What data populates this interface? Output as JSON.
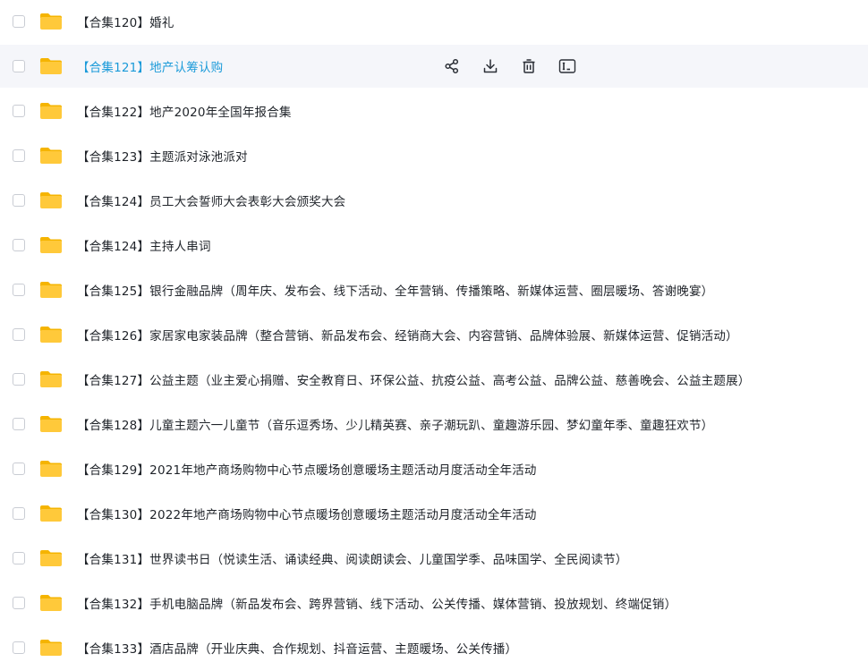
{
  "colors": {
    "folder": "#ffc93a",
    "folder_tab": "#f5b400",
    "hover_background": "#f5f6fa",
    "hover_text": "#1a9ad9",
    "text": "#1f2329",
    "icon": "#2b2f36"
  },
  "row_actions": [
    {
      "name": "share-button",
      "icon": "share-icon"
    },
    {
      "name": "download-button",
      "icon": "download-icon"
    },
    {
      "name": "delete-button",
      "icon": "trash-icon"
    },
    {
      "name": "rename-button",
      "icon": "rename-icon"
    }
  ],
  "files": [
    {
      "name": "【合集120】婚礼"
    },
    {
      "name": "【合集121】地产认筹认购",
      "hovered": true
    },
    {
      "name": "【合集122】地产2020年全国年报合集"
    },
    {
      "name": "【合集123】主题派对泳池派对"
    },
    {
      "name": "【合集124】员工大会誓师大会表彰大会颁奖大会"
    },
    {
      "name": "【合集124】主持人串词"
    },
    {
      "name": "【合集125】银行金融品牌（周年庆、发布会、线下活动、全年营销、传播策略、新媒体运营、圈层暖场、答谢晚宴）"
    },
    {
      "name": "【合集126】家居家电家装品牌（整合营销、新品发布会、经销商大会、内容营销、品牌体验展、新媒体运营、促销活动）"
    },
    {
      "name": "【合集127】公益主题（业主爱心捐赠、安全教育日、环保公益、抗疫公益、高考公益、品牌公益、慈善晚会、公益主题展）"
    },
    {
      "name": "【合集128】儿童主题六一儿童节（音乐逗秀场、少儿精英赛、亲子潮玩趴、童趣游乐园、梦幻童年季、童趣狂欢节）"
    },
    {
      "name": "【合集129】2021年地产商场购物中心节点暖场创意暖场主题活动月度活动全年活动"
    },
    {
      "name": "【合集130】2022年地产商场购物中心节点暖场创意暖场主题活动月度活动全年活动"
    },
    {
      "name": "【合集131】世界读书日（悦读生活、诵读经典、阅读朗读会、儿童国学季、品味国学、全民阅读节）"
    },
    {
      "name": "【合集132】手机电脑品牌（新品发布会、跨界营销、线下活动、公关传播、媒体营销、投放规划、终端促销）"
    },
    {
      "name": "【合集133】酒店品牌（开业庆典、合作规划、抖音运营、主题暖场、公关传播）"
    }
  ]
}
